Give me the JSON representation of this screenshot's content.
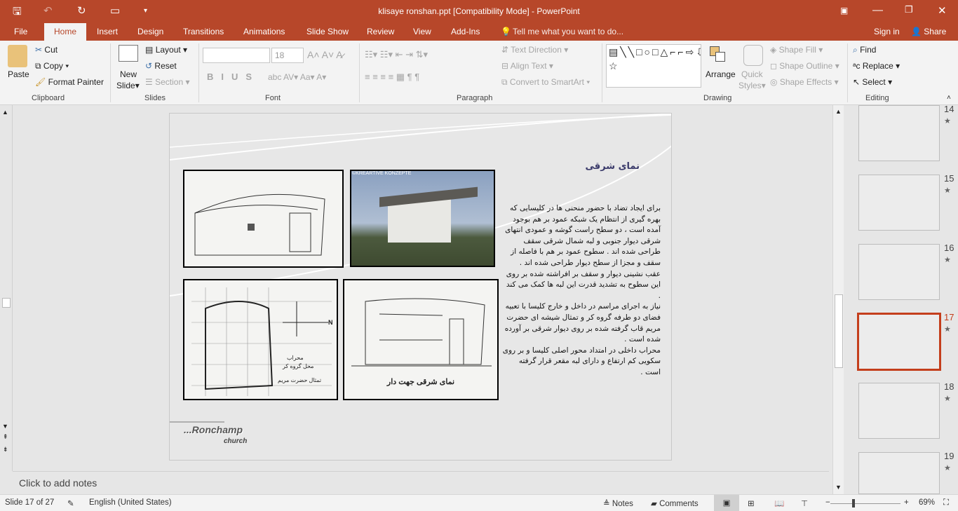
{
  "window": {
    "title": "klisaye ronshan.ppt [Compatibility Mode] - PowerPoint"
  },
  "tabs": [
    {
      "label": "File"
    },
    {
      "label": "Home"
    },
    {
      "label": "Insert"
    },
    {
      "label": "Design"
    },
    {
      "label": "Transitions"
    },
    {
      "label": "Animations"
    },
    {
      "label": "Slide Show"
    },
    {
      "label": "Review"
    },
    {
      "label": "View"
    },
    {
      "label": "Add-Ins"
    }
  ],
  "tell_me": "Tell me what you want to do...",
  "sign_in": "Sign in",
  "share": "Share",
  "ribbon": {
    "clipboard": {
      "paste": "Paste",
      "cut": "Cut",
      "copy": "Copy",
      "format_painter": "Format Painter",
      "group": "Clipboard"
    },
    "slides": {
      "new_slide": "New",
      "new_slide2": "Slide",
      "layout": "Layout",
      "reset": "Reset",
      "section": "Section",
      "group": "Slides"
    },
    "font": {
      "font_size": "18",
      "group": "Font"
    },
    "paragraph": {
      "text_direction": "Text Direction",
      "align_text": "Align Text",
      "convert_smartart": "Convert to SmartArt",
      "group": "Paragraph"
    },
    "drawing": {
      "arrange": "Arrange",
      "quick_styles": "Quick",
      "quick_styles2": "Styles",
      "shape_fill": "Shape Fill",
      "shape_outline": "Shape Outline",
      "shape_effects": "Shape Effects",
      "group": "Drawing"
    },
    "editing": {
      "find": "Find",
      "replace": "Replace",
      "select": "Select",
      "group": "Editing"
    }
  },
  "slide": {
    "title": "نمای شرقی",
    "photo_credit": "©KREARTIVE KONZEPTE",
    "plan_labels": [
      "محراب",
      "محل گروه کر",
      "تمثال حضرت مریم"
    ],
    "plan_north": "N",
    "elevation_caption": "نمای شرقی جهت دار",
    "body": [
      "برای ایجاد تضاد با حضور منحنی ها در کلیسایی که بهره گیری از انتظام یک شبکه عمود بر هم بوجود آمده است ، دو سطح راست گوشه و عمودی انتهای شرقی دیوار جنوبی و لبه شمال شرقی سقف طراحی شده اند . سطوح عمود بر هم با فاصله از سقف و مجزا از سطح دیوار طراحی شده اند .",
      "عقب نشینی دیوار و سقف بر افراشته شده بر روی این سطوح به تشدید قدرت این لبه ها کمک می کند .",
      "نیاز به اجرای مراسم در داخل و خارج کلیسا با تعبیه فضای دو طرفه گروه کر و تمثال شیشه ای حضرت مریم قاب گرفته شده بر روی دیوار شرقی بر آورده شده است .",
      "محراب داخلی در امتداد محور اصلی کلیسا و بر روی سکویی کم ارتفاع و دارای لبه مقعر قرار گرفته است ."
    ],
    "logo": "...Ronchamp",
    "logo_sub": "church"
  },
  "notes_placeholder": "Click to add notes",
  "thumbnails": [
    {
      "num": "14"
    },
    {
      "num": "15"
    },
    {
      "num": "16"
    },
    {
      "num": "17"
    },
    {
      "num": "18"
    },
    {
      "num": "19"
    }
  ],
  "selected_slide": "17",
  "status": {
    "slide": "Slide 17 of 27",
    "language": "English (United States)",
    "notes": "Notes",
    "comments": "Comments",
    "zoom": "69%",
    "zoom_percent": 69
  },
  "colors": {
    "accent": "#b7472a",
    "selected": "#c43e1c"
  }
}
